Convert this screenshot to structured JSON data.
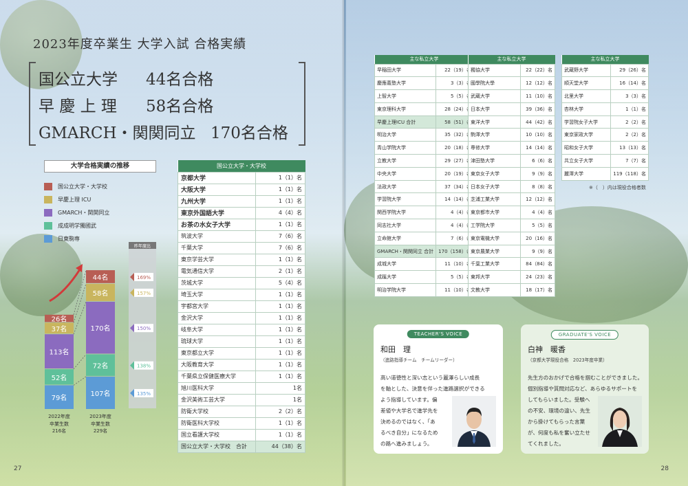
{
  "title": "2023年度卒業生 大学入試 合格実績",
  "headline": [
    {
      "label": "国公立大学",
      "value": "44名合格"
    },
    {
      "label": "早 慶 上 理",
      "value": "58名合格"
    },
    {
      "label": "GMARCH・関関同立",
      "value": "170名合格"
    }
  ],
  "chart_data": {
    "type": "bar",
    "title": "大学合格実績の推移",
    "stacked": true,
    "categories": [
      "2022年度",
      "2023年度"
    ],
    "category_notes": [
      "卒業生数 216名",
      "卒業生数 229名"
    ],
    "series": [
      {
        "name": "国公立大学・大学校",
        "color": "#b85e54",
        "values": [
          26,
          44
        ]
      },
      {
        "name": "早慶上理 ICU",
        "color": "#c9b55e",
        "values": [
          37,
          58
        ]
      },
      {
        "name": "GMARCH・関関同立",
        "color": "#8b6bbf",
        "values": [
          113,
          170
        ]
      },
      {
        "name": "成成明学獨國武",
        "color": "#5fc09a",
        "values": [
          52,
          72
        ]
      },
      {
        "name": "日東駒専",
        "color": "#5c9bd6",
        "values": [
          79,
          107
        ]
      }
    ],
    "unit": "名",
    "ratio_label": "昨年度比",
    "ratios": [
      "169%",
      "157%",
      "150%",
      "138%",
      "135%"
    ]
  },
  "national_table": {
    "header": "国公立大学・大学校",
    "rows": [
      {
        "name": "京都大学",
        "value": "1（1）名",
        "bold": true
      },
      {
        "name": "大阪大学",
        "value": "1（1）名",
        "bold": true
      },
      {
        "name": "九州大学",
        "value": "1（1）名",
        "bold": true
      },
      {
        "name": "東京外国語大学",
        "value": "4（4）名",
        "bold": true
      },
      {
        "name": "お茶の水女子大学",
        "value": "1（1）名",
        "bold": true
      },
      {
        "name": "筑波大学",
        "value": "7（6）名"
      },
      {
        "name": "千葉大学",
        "value": "7（6）名"
      },
      {
        "name": "東京学芸大学",
        "value": "1（1）名"
      },
      {
        "name": "電気通信大学",
        "value": "2（1）名"
      },
      {
        "name": "茨城大学",
        "value": "5（4）名"
      },
      {
        "name": "埼玉大学",
        "value": "1（1）名"
      },
      {
        "name": "宇都宮大学",
        "value": "1（1）名"
      },
      {
        "name": "金沢大学",
        "value": "1（1）名"
      },
      {
        "name": "岐阜大学",
        "value": "1（1）名"
      },
      {
        "name": "琉球大学",
        "value": "1（1）名"
      },
      {
        "name": "東京都立大学",
        "value": "1（1）名"
      },
      {
        "name": "大阪教育大学",
        "value": "1（1）名"
      },
      {
        "name": "千葉県立保健医療大学",
        "value": "1（1）名"
      },
      {
        "name": "旭川医科大学",
        "value": "1名"
      },
      {
        "name": "金沢美術工芸大学",
        "value": "1名"
      },
      {
        "name": "防衛大学校",
        "value": "2（2）名"
      },
      {
        "name": "防衛医科大学校",
        "value": "1（1）名"
      },
      {
        "name": "国立看護大学校",
        "value": "1（1）名"
      }
    ],
    "total": {
      "name": "国公立大学・大学校　合計",
      "value": "44（38）名"
    }
  },
  "private_tables": [
    {
      "header": "主な私立大学",
      "rows": [
        {
          "name": "早稲田大学",
          "value": "22（19）名"
        },
        {
          "name": "慶應義塾大学",
          "value": "3（3）名"
        },
        {
          "name": "上智大学",
          "value": "5（5）名"
        },
        {
          "name": "東京理科大学",
          "value": "28（24）名"
        },
        {
          "name": "早慶上理ICU 合計",
          "value": "58（51）名",
          "total": true
        },
        {
          "name": "明治大学",
          "value": "35（32）名"
        },
        {
          "name": "青山学院大学",
          "value": "20（18）名"
        },
        {
          "name": "立教大学",
          "value": "29（27）名"
        },
        {
          "name": "中央大学",
          "value": "20（19）名"
        },
        {
          "name": "法政大学",
          "value": "37（34）名"
        },
        {
          "name": "学習院大学",
          "value": "14（14）名"
        },
        {
          "name": "関西学院大学",
          "value": "4（4）名"
        },
        {
          "name": "同志社大学",
          "value": "4（4）名"
        },
        {
          "name": "立命館大学",
          "value": "7（6）名"
        },
        {
          "name": "GMARCH・関関同立 合計",
          "value": "170（158）名",
          "total": true
        },
        {
          "name": "成城大学",
          "value": "11（10）名"
        },
        {
          "name": "成蹊大学",
          "value": "5（5）名"
        },
        {
          "name": "明治学院大学",
          "value": "11（10）名"
        }
      ]
    },
    {
      "header": "主な私立大学",
      "rows": [
        {
          "name": "獨協大学",
          "value": "22（22）名"
        },
        {
          "name": "國學院大學",
          "value": "12（12）名"
        },
        {
          "name": "武蔵大学",
          "value": "11（10）名"
        },
        {
          "name": "日本大学",
          "value": "39（36）名"
        },
        {
          "name": "東洋大学",
          "value": "44（42）名"
        },
        {
          "name": "駒澤大学",
          "value": "10（10）名"
        },
        {
          "name": "専修大学",
          "value": "14（14）名"
        },
        {
          "name": "津田塾大学",
          "value": "6（6）名"
        },
        {
          "name": "東京女子大学",
          "value": "9（9）名"
        },
        {
          "name": "日本女子大学",
          "value": "8（8）名"
        },
        {
          "name": "芝浦工業大学",
          "value": "12（12）名"
        },
        {
          "name": "東京都市大学",
          "value": "4（4）名"
        },
        {
          "name": "工学院大学",
          "value": "5（5）名"
        },
        {
          "name": "東京電機大学",
          "value": "20（16）名"
        },
        {
          "name": "東京農業大学",
          "value": "9（9）名"
        },
        {
          "name": "千葉工業大学",
          "value": "84（84）名"
        },
        {
          "name": "東邦大学",
          "value": "24（23）名"
        },
        {
          "name": "文教大学",
          "value": "18（17）名"
        }
      ]
    },
    {
      "header": "主な私立大学",
      "rows": [
        {
          "name": "武蔵野大学",
          "value": "29（26）名"
        },
        {
          "name": "順天堂大学",
          "value": "16（14）名"
        },
        {
          "name": "北里大学",
          "value": "3（3）名"
        },
        {
          "name": "杏林大学",
          "value": "1（1）名"
        },
        {
          "name": "学習院女子大学",
          "value": "2（2）名"
        },
        {
          "name": "東京家政大学",
          "value": "2（2）名"
        },
        {
          "name": "昭和女子大学",
          "value": "13（13）名"
        },
        {
          "name": "共立女子大学",
          "value": "7（7）名"
        },
        {
          "name": "麗澤大学",
          "value": "119（118）名"
        }
      ]
    }
  ],
  "note": "※（　）内は現役合格者数",
  "teacher_voice": {
    "badge": "TEACHER'S VOICE",
    "name": "和田　理",
    "role": "（進路指導チーム　チームリーダー）",
    "lines": [
      "高い道徳性と深い志という麗澤らしい成長",
      "を軸とした、決意を伴った進路選択ができる",
      "よう指導しています。偏",
      "差値や大学名で進学先を",
      "決めるのではなく、「あ",
      "るべき自分」になるため",
      "の路へ進みましょう。"
    ]
  },
  "graduate_voice": {
    "badge": "GRADUATE'S VOICE",
    "name": "白神　暖香",
    "role": "（京都大学現役合格　2023年度卒業）",
    "lines": [
      "先生方のおかげで合格を掴むことができました。",
      "個別指導や質問対応など、あらゆるサポートを",
      "してもらいました。受験へ",
      "の不安、環境の違い、先生",
      "から掛けてもらった言葉",
      "が、何度も私を奮い立たせ",
      "てくれました。"
    ]
  },
  "page_left": "27",
  "page_right": "28"
}
